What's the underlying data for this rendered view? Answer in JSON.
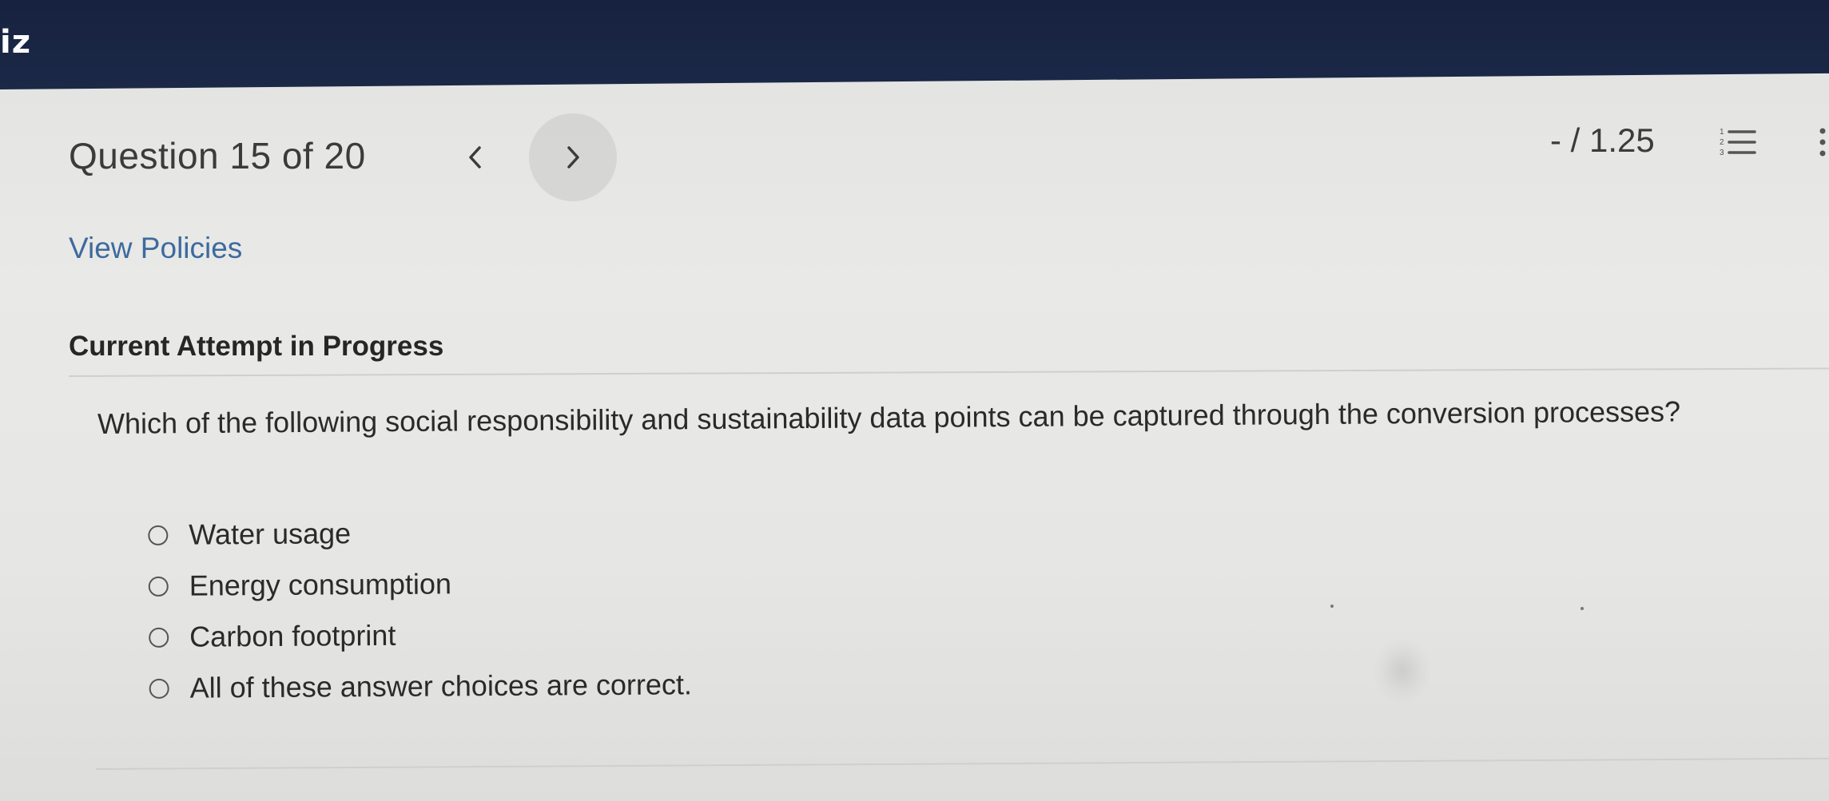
{
  "app": {
    "title_fragment": "iz"
  },
  "header": {
    "question_position": "Question 15 of 20",
    "score": "- / 1.25",
    "nav_prev_icon": "chevron-left-icon",
    "nav_next_icon": "chevron-right-icon",
    "list_icon": "numbered-list-icon",
    "more_icon": "more-vertical-icon"
  },
  "links": {
    "view_policies": "View Policies"
  },
  "attempt": {
    "heading": "Current Attempt in Progress"
  },
  "question": {
    "text": "Which of the following social responsibility and sustainability data points can be captured through the conversion processes?",
    "options": [
      {
        "label": "Water usage",
        "selected": false
      },
      {
        "label": "Energy consumption",
        "selected": false
      },
      {
        "label": "Carbon footprint",
        "selected": false
      },
      {
        "label": "All of these answer choices are correct.",
        "selected": false
      }
    ]
  },
  "colors": {
    "header_bar": "#1b2847",
    "link": "#3d6a9e",
    "page_background": "#e6e6e4"
  }
}
